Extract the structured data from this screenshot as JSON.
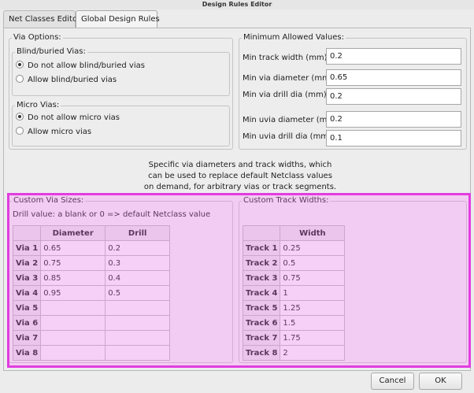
{
  "window": {
    "title": "Design Rules Editor"
  },
  "tabs": [
    {
      "label": "Net Classes Editor",
      "active": false
    },
    {
      "label": "Global Design Rules",
      "active": true
    }
  ],
  "via_options": {
    "title": "Via Options:",
    "blind": {
      "title": "Blind/buried Vias:",
      "options": [
        "Do not allow blind/buried vias",
        "Allow blind/buried vias"
      ],
      "selected": 0
    },
    "micro": {
      "title": "Micro Vias:",
      "options": [
        "Do not allow micro vias",
        "Allow micro vias"
      ],
      "selected": 0
    }
  },
  "min_values": {
    "title": "Minimum Allowed Values:",
    "fields": [
      {
        "label": "Min track width (mm):",
        "value": "0.2"
      },
      {
        "label": "Min via diameter (mm):",
        "value": "0.65"
      },
      {
        "label": "Min via drill dia (mm):",
        "value": "0.2"
      },
      {
        "label": "Min uvia diameter (mm):",
        "value": "0.2"
      },
      {
        "label": "Min uvia drill dia (mm):",
        "value": "0.1"
      }
    ]
  },
  "info_text": [
    "Specific via diameters and track widths, which",
    "can be used to replace default Netclass values",
    "on demand, for arbitrary vias or track segments."
  ],
  "via_sizes": {
    "title": "Custom Via Sizes:",
    "hint": "Drill value: a blank or 0 => default Netclass value",
    "columns": [
      "Diameter",
      "Drill"
    ],
    "rows": [
      {
        "label": "Via 1",
        "diameter": "0.65",
        "drill": "0.2"
      },
      {
        "label": "Via 2",
        "diameter": "0.75",
        "drill": "0.3"
      },
      {
        "label": "Via 3",
        "diameter": "0.85",
        "drill": "0.4"
      },
      {
        "label": "Via 4",
        "diameter": "0.95",
        "drill": "0.5"
      },
      {
        "label": "Via 5",
        "diameter": "",
        "drill": ""
      },
      {
        "label": "Via 6",
        "diameter": "",
        "drill": ""
      },
      {
        "label": "Via 7",
        "diameter": "",
        "drill": ""
      },
      {
        "label": "Via 8",
        "diameter": "",
        "drill": ""
      }
    ]
  },
  "track_widths": {
    "title": "Custom Track Widths:",
    "columns": [
      "Width"
    ],
    "rows": [
      {
        "label": "Track 1",
        "width": "0.25"
      },
      {
        "label": "Track 2",
        "width": "0.5"
      },
      {
        "label": "Track 3",
        "width": "0.75"
      },
      {
        "label": "Track 4",
        "width": "1"
      },
      {
        "label": "Track 5",
        "width": "1.25"
      },
      {
        "label": "Track 6",
        "width": "1.5"
      },
      {
        "label": "Track 7",
        "width": "1.75"
      },
      {
        "label": "Track 8",
        "width": "2"
      }
    ]
  },
  "buttons": {
    "cancel": "Cancel",
    "ok": "OK"
  },
  "colors": {
    "highlight_border": "#e13de0",
    "highlight_fill": "#ffc6ff"
  }
}
